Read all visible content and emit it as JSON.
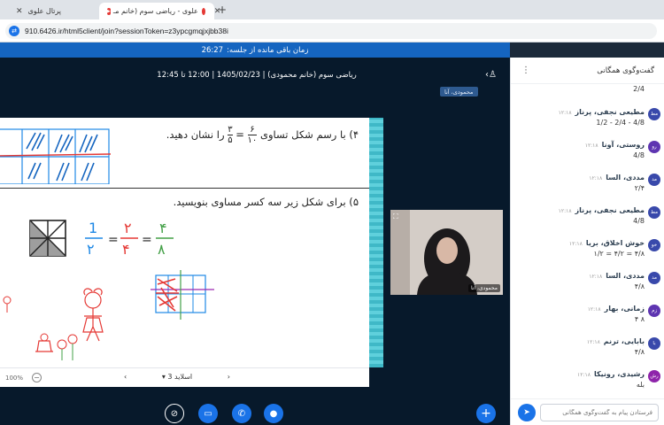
{
  "browser": {
    "tabs": [
      {
        "label": "پرتال علوی",
        "active": false
      },
      {
        "label": "علوی - ریاضی سوم (خانم مـ",
        "active": true
      }
    ],
    "new_tab_symbol": "+",
    "url": "910.6426.ir/html5client/join?sessionToken=z3ypcgmqjxjbb38i"
  },
  "session": {
    "remaining_label": "زمان باقی مانده از جلسه:",
    "remaining_time": "26:27",
    "room_title": "ریاضی سوم (خانم محمودی) | 1405/02/23 | 12:00 تا 12:45",
    "presenter_tag": "محمودی، آنا"
  },
  "slide": {
    "q4": "۴) با رسم شکل تساوی",
    "q4_frac1": {
      "num": "۶",
      "den": "۱۰"
    },
    "q4_frac2": {
      "num": "۳",
      "den": "۵"
    },
    "q4_suffix": "را نشان دهید.",
    "q5": "۵) برای شکل زیر سه کسر مساوی بنویسید.",
    "hand_fracs": [
      "1/2",
      "2/4",
      "4/8"
    ],
    "zoom": "100%",
    "zoom_minus": "−",
    "slide_selector": "اسلاید 3",
    "nav_prev": "‹",
    "nav_next": "›"
  },
  "webcam": {
    "label": "محمودی، آنا"
  },
  "actions": {
    "screen": "screen-share-off-icon",
    "camera": "camera-icon",
    "phone": "phone-icon",
    "mic": "microphone-icon",
    "plus": "+"
  },
  "chat": {
    "title": "گفت‌وگوی همگانی",
    "kebab": "⋮",
    "input_placeholder": "فرستادن پیام به گفت‌وگوی همگانی",
    "top_fragment": "2/4",
    "messages": [
      {
        "initials": "مط",
        "name": "مطیعی نجفی، پرناز",
        "time": "۱۲:۱۸",
        "text": "4/8 - 2/4 - 1/2",
        "color": "#3949ab"
      },
      {
        "initials": "رو",
        "name": "روستی، آونا",
        "time": "۱۲:۱۸",
        "text": "4/8",
        "color": "#5e35b1"
      },
      {
        "initials": "مد",
        "name": "مددی، السا",
        "time": "۱۲:۱۸",
        "text": "۲/۴",
        "color": "#3949ab"
      },
      {
        "initials": "مط",
        "name": "مطیعی نجفی، پرناز",
        "time": "۱۲:۱۸",
        "text": "4/8",
        "color": "#3949ab"
      },
      {
        "initials": "خو",
        "name": "خوش اخلاق، بریا",
        "time": "۱۲:۱۸",
        "text": "۴/۸ = ۴/۲ = ۱/۲",
        "color": "#3949ab"
      },
      {
        "initials": "مد",
        "name": "مددی، السا",
        "time": "۱۲:۱۸",
        "text": "۴/۸",
        "color": "#3949ab"
      },
      {
        "initials": "زم",
        "name": "زمانی، بهار",
        "time": "۱۲:۱۸",
        "text": "۸ ۴",
        "color": "#5e35b1"
      },
      {
        "initials": "با",
        "name": "بابایی، ترنم",
        "time": "۱۲:۱۸",
        "text": "۴/۸",
        "color": "#3949ab"
      },
      {
        "initials": "رش",
        "name": "رشیدی، رونیکا",
        "time": "۱۲:۱۸",
        "text": "بله",
        "color": "#8e24aa"
      }
    ]
  }
}
